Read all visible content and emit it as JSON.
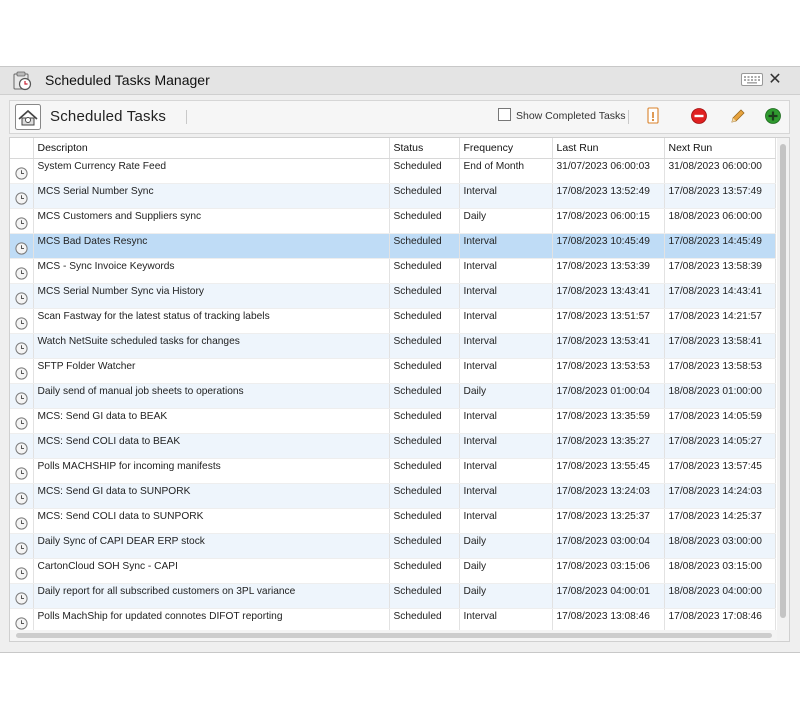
{
  "window": {
    "title": "Scheduled Tasks Manager"
  },
  "toolbar": {
    "section_title": "Scheduled Tasks",
    "show_completed_label": "Show Completed Tasks"
  },
  "colors": {
    "selected_row": "#bfdcf6",
    "alt_row": "#eef5fc",
    "delete_red": "#e02020",
    "add_green": "#2f9a2f"
  },
  "grid": {
    "columns": [
      "Descripton",
      "Status",
      "Frequency",
      "Last Run",
      "Next Run"
    ],
    "rows": [
      {
        "desc": "System Currency Rate Feed",
        "status": "Scheduled",
        "freq": "End of Month",
        "last": "31/07/2023 06:00:03",
        "next": "31/08/2023 06:00:00"
      },
      {
        "desc": "MCS Serial Number Sync",
        "status": "Scheduled",
        "freq": "Interval",
        "last": "17/08/2023 13:52:49",
        "next": "17/08/2023 13:57:49"
      },
      {
        "desc": "MCS Customers and Suppliers sync",
        "status": "Scheduled",
        "freq": "Daily",
        "last": "17/08/2023 06:00:15",
        "next": "18/08/2023 06:00:00"
      },
      {
        "desc": "MCS Bad Dates Resync",
        "status": "Scheduled",
        "freq": "Interval",
        "last": "17/08/2023 10:45:49",
        "next": "17/08/2023 14:45:49",
        "selected": true
      },
      {
        "desc": "MCS - Sync Invoice Keywords",
        "status": "Scheduled",
        "freq": "Interval",
        "last": "17/08/2023 13:53:39",
        "next": "17/08/2023 13:58:39"
      },
      {
        "desc": "MCS Serial Number Sync via History",
        "status": "Scheduled",
        "freq": "Interval",
        "last": "17/08/2023 13:43:41",
        "next": "17/08/2023 14:43:41"
      },
      {
        "desc": "Scan Fastway for the latest status of tracking labels",
        "status": "Scheduled",
        "freq": "Interval",
        "last": "17/08/2023 13:51:57",
        "next": "17/08/2023 14:21:57"
      },
      {
        "desc": "Watch NetSuite scheduled tasks for changes",
        "status": "Scheduled",
        "freq": "Interval",
        "last": "17/08/2023 13:53:41",
        "next": "17/08/2023 13:58:41"
      },
      {
        "desc": "SFTP Folder Watcher",
        "status": "Scheduled",
        "freq": "Interval",
        "last": "17/08/2023 13:53:53",
        "next": "17/08/2023 13:58:53"
      },
      {
        "desc": "Daily send of manual job sheets to operations",
        "status": "Scheduled",
        "freq": "Daily",
        "last": "17/08/2023 01:00:04",
        "next": "18/08/2023 01:00:00"
      },
      {
        "desc": "MCS: Send GI data to BEAK",
        "status": "Scheduled",
        "freq": "Interval",
        "last": "17/08/2023 13:35:59",
        "next": "17/08/2023 14:05:59"
      },
      {
        "desc": "MCS: Send COLI data to BEAK",
        "status": "Scheduled",
        "freq": "Interval",
        "last": "17/08/2023 13:35:27",
        "next": "17/08/2023 14:05:27"
      },
      {
        "desc": "Polls MACHSHIP for incoming manifests",
        "status": "Scheduled",
        "freq": "Interval",
        "last": "17/08/2023 13:55:45",
        "next": "17/08/2023 13:57:45"
      },
      {
        "desc": "MCS: Send GI data to SUNPORK",
        "status": "Scheduled",
        "freq": "Interval",
        "last": "17/08/2023 13:24:03",
        "next": "17/08/2023 14:24:03"
      },
      {
        "desc": "MCS: Send COLI data to SUNPORK",
        "status": "Scheduled",
        "freq": "Interval",
        "last": "17/08/2023 13:25:37",
        "next": "17/08/2023 14:25:37"
      },
      {
        "desc": "Daily Sync of CAPI DEAR ERP stock",
        "status": "Scheduled",
        "freq": "Daily",
        "last": "17/08/2023 03:00:04",
        "next": "18/08/2023 03:00:00"
      },
      {
        "desc": "CartonCloud SOH Sync - CAPI",
        "status": "Scheduled",
        "freq": "Daily",
        "last": "17/08/2023 03:15:06",
        "next": "18/08/2023 03:15:00"
      },
      {
        "desc": "Daily report for all subscribed customers on 3PL variance",
        "status": "Scheduled",
        "freq": "Daily",
        "last": "17/08/2023 04:00:01",
        "next": "18/08/2023 04:00:00"
      },
      {
        "desc": "Polls MachShip for updated connotes DIFOT reporting",
        "status": "Scheduled",
        "freq": "Interval",
        "last": "17/08/2023 13:08:46",
        "next": "17/08/2023 17:08:46"
      }
    ]
  }
}
